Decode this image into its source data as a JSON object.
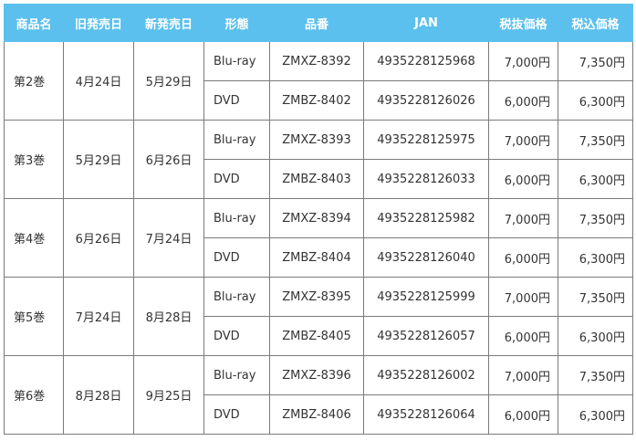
{
  "table": {
    "headers": [
      "商品名",
      "旧発売日",
      "新発売日",
      "形態",
      "品番",
      "JAN",
      "税抜価格",
      "税込価格"
    ],
    "volumes": [
      {
        "name": "第2巻",
        "old_date": "4月24日",
        "new_date": "5月29日",
        "items": [
          {
            "format": "Blu-ray",
            "code": "ZMXZ-8392",
            "jan": "4935228125968",
            "price_ex": "7,000円",
            "price_in": "7,350円"
          },
          {
            "format": "DVD",
            "code": "ZMBZ-8402",
            "jan": "4935228126026",
            "price_ex": "6,000円",
            "price_in": "6,300円"
          }
        ]
      },
      {
        "name": "第3巻",
        "old_date": "5月29日",
        "new_date": "6月26日",
        "items": [
          {
            "format": "Blu-ray",
            "code": "ZMXZ-8393",
            "jan": "4935228125975",
            "price_ex": "7,000円",
            "price_in": "7,350円"
          },
          {
            "format": "DVD",
            "code": "ZMBZ-8403",
            "jan": "4935228126033",
            "price_ex": "6,000円",
            "price_in": "6,300円"
          }
        ]
      },
      {
        "name": "第4巻",
        "old_date": "6月26日",
        "new_date": "7月24日",
        "items": [
          {
            "format": "Blu-ray",
            "code": "ZMXZ-8394",
            "jan": "4935228125982",
            "price_ex": "7,000円",
            "price_in": "7,350円"
          },
          {
            "format": "DVD",
            "code": "ZMBZ-8404",
            "jan": "4935228126040",
            "price_ex": "6,000円",
            "price_in": "6,300円"
          }
        ]
      },
      {
        "name": "第5巻",
        "old_date": "7月24日",
        "new_date": "8月28日",
        "items": [
          {
            "format": "Blu-ray",
            "code": "ZMXZ-8395",
            "jan": "4935228125999",
            "price_ex": "7,000円",
            "price_in": "7,350円"
          },
          {
            "format": "DVD",
            "code": "ZMBZ-8405",
            "jan": "4935228126057",
            "price_ex": "6,000円",
            "price_in": "6,300円"
          }
        ]
      },
      {
        "name": "第6巻",
        "old_date": "8月28日",
        "new_date": "9月25日",
        "items": [
          {
            "format": "Blu-ray",
            "code": "ZMXZ-8396",
            "jan": "4935228126002",
            "price_ex": "7,000円",
            "price_in": "7,350円"
          },
          {
            "format": "DVD",
            "code": "ZMBZ-8406",
            "jan": "4935228126064",
            "price_ex": "6,000円",
            "price_in": "6,300円"
          }
        ]
      }
    ]
  },
  "colors": {
    "header_bg": "#5bc0ee",
    "header_text": "#ffffff",
    "border": "#7a7a7a",
    "cell_text": "#333333"
  }
}
